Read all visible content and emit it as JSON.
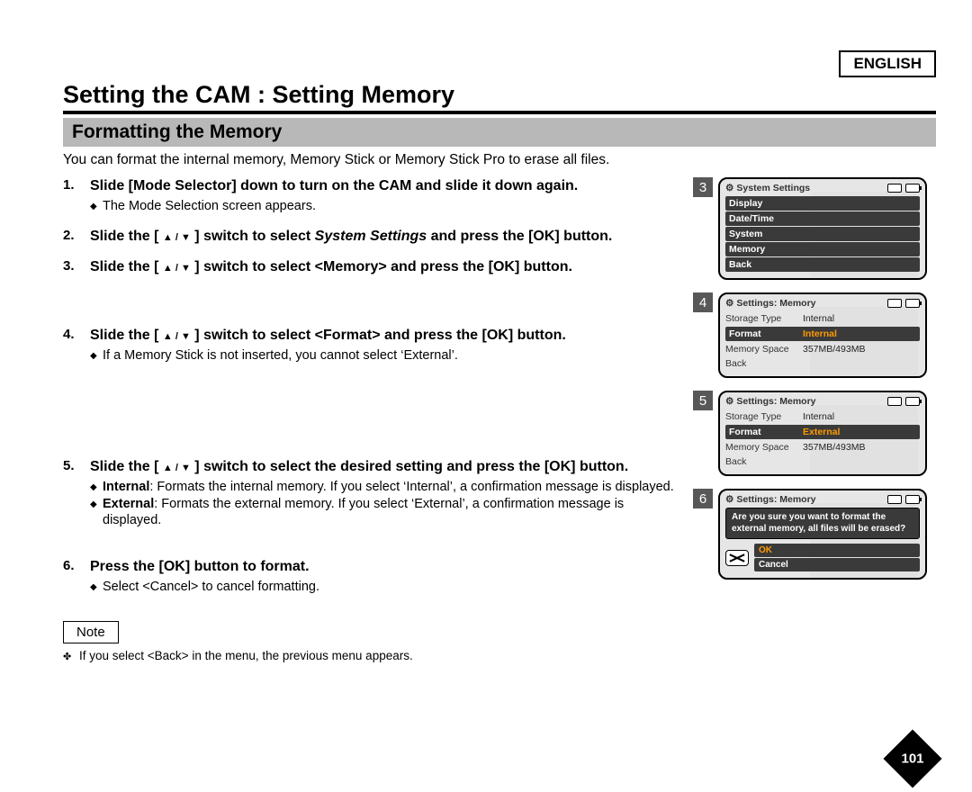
{
  "language": "ENGLISH",
  "title": "Setting the CAM : Setting Memory",
  "subtitle": "Formatting the Memory",
  "intro": "You can format the internal memory, Memory Stick or Memory Stick Pro to erase all files.",
  "steps": {
    "s1": {
      "head": "Slide [Mode Selector] down to turn on the CAM and slide it down again.",
      "bul1": "The Mode Selection screen appears."
    },
    "s2": {
      "head_a": "Slide the [ ",
      "head_b": " ] switch to select ",
      "head_em": "System Settings",
      "head_c": " and press the [OK] button."
    },
    "s3": {
      "head_a": "Slide the [ ",
      "head_b": " ] switch to select <Memory> and press the [OK] button."
    },
    "s4": {
      "head_a": "Slide the [ ",
      "head_b": " ] switch to select <Format> and press the [OK] button.",
      "bul1": "If a Memory Stick is not inserted, you cannot select ‘External’."
    },
    "s5": {
      "head_a": "Slide the [ ",
      "head_b": " ] switch to select the desired setting and press the [OK] button.",
      "bul_int_label": "Internal",
      "bul_int": ": Formats the internal memory. If you select  ‘Internal’, a confirmation message is displayed.",
      "bul_ext_label": "External",
      "bul_ext": ": Formats the external memory. If you select ‘External’, a confirmation message is displayed."
    },
    "s6": {
      "head": "Press the [OK] button to format.",
      "bul1": "Select <Cancel> to cancel formatting."
    }
  },
  "note_label": "Note",
  "note_text": "If you select <Back> in the menu, the previous menu appears.",
  "arrows": "▲ / ▼",
  "screens": {
    "sc3": {
      "num": "3",
      "title": "System Settings",
      "items": [
        "Display",
        "Date/Time",
        "System",
        "Memory",
        "Back"
      ]
    },
    "sc4": {
      "num": "4",
      "title": "Settings: Memory",
      "r1_l": "Storage Type",
      "r1_v": "Internal",
      "r2_l": "Format",
      "r2_v": "Internal",
      "r3_l": "Memory Space",
      "r3_v": "357MB/493MB",
      "r4_l": "Back"
    },
    "sc5": {
      "num": "5",
      "title": "Settings: Memory",
      "r1_l": "Storage Type",
      "r1_v": "Internal",
      "r2_l": "Format",
      "r2_v": "External",
      "r3_l": "Memory Space",
      "r3_v": "357MB/493MB",
      "r4_l": "Back"
    },
    "sc6": {
      "num": "6",
      "title": "Settings: Memory",
      "confirm": "Are you sure you want to format the external memory, all files will be erased?",
      "ok": "OK",
      "cancel": "Cancel"
    }
  },
  "page": "101"
}
